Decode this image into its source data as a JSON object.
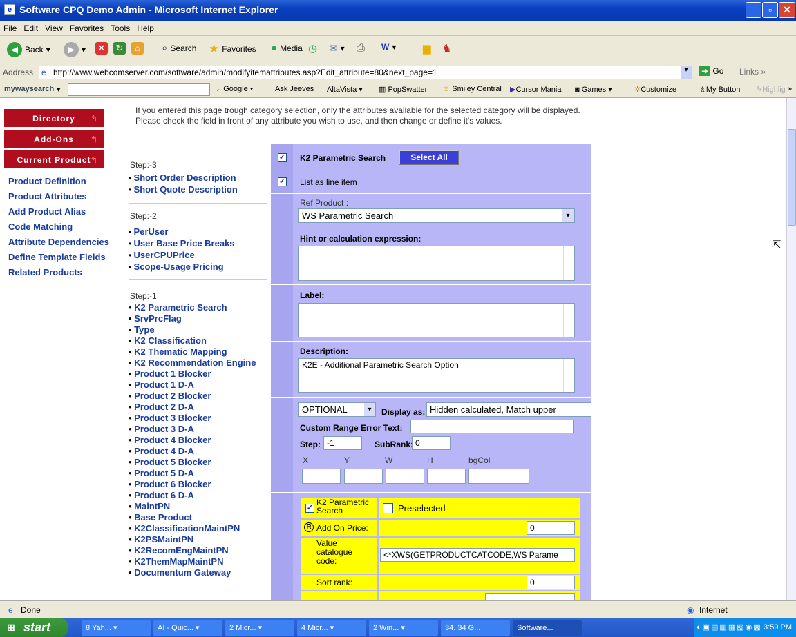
{
  "window": {
    "title": "Software CPQ Demo Admin - Microsoft Internet Explorer"
  },
  "menu": [
    "File",
    "Edit",
    "View",
    "Favorites",
    "Tools",
    "Help"
  ],
  "toolbar": {
    "back": "Back",
    "search": "Search",
    "favorites": "Favorites",
    "media": "Media"
  },
  "address": {
    "label": "Address",
    "url": "http://www.webcomserver.com/software/admin/modifyitemattributes.asp?Edit_attribute=80&next_page=1",
    "go": "Go",
    "links": "Links"
  },
  "myway": {
    "brand": "mywaysearch",
    "items": [
      "Google",
      "Ask Jeeves",
      "AltaVista",
      "PopSwatter",
      "Smiley Central",
      "Cursor Mania",
      "Games",
      "Customize",
      "My Button",
      "Highlight"
    ]
  },
  "intro": "If you entered this page trough category selection, only the attributes available for the selected category will be displayed. Please check the field in front of any attribute you wish to use, and then change or define it's values.",
  "nav": {
    "buttons": [
      "Directory",
      "Add-Ons",
      "Current Product"
    ],
    "links": [
      "Product Definition",
      "Product Attributes",
      "Add Product Alias",
      "Code Matching",
      "Attribute Dependencies",
      "Define Template Fields",
      "Related Products"
    ]
  },
  "steps": [
    {
      "label": "Step:-3",
      "items": [
        "Short Order Description",
        "Short Quote Description"
      ]
    },
    {
      "label": "Step:-2",
      "items": [
        "PerUser",
        "User Base Price Breaks",
        "UserCPUPrice",
        "Scope-Usage Pricing"
      ]
    },
    {
      "label": "Step:-1",
      "items": [
        "K2 Parametric Search",
        "SrvPrcFlag",
        "Type",
        "K2 Classification",
        "K2 Thematic Mapping",
        "K2 Recommendation Engine",
        "Product 1 Blocker",
        "Product 1 D-A",
        "Product 2 Blocker",
        "Product 2 D-A",
        "Product 3 Blocker",
        "Product 3 D-A",
        "Product 4 Blocker",
        "Product 4 D-A",
        "Product 5 Blocker",
        "Product 5 D-A",
        "Product 6 Blocker",
        "Product 6 D-A",
        "MaintPN",
        "Base Product",
        "K2ClassificationMaintPN",
        "K2PSMaintPN",
        "K2RecomEngMaintPN",
        "K2ThemMapMaintPN",
        "Documentum Gateway"
      ]
    }
  ],
  "form": {
    "attr_name": "K2 Parametric Search",
    "select_all": "Select All",
    "list_as_line_item": "List as line item",
    "ref_product_label": "Ref Product :",
    "ref_product_value": "WS Parametric Search",
    "hint_label": "Hint or calculation expression:",
    "hint_value": "",
    "label_label": "Label:",
    "label_value": "",
    "desc_label": "Description:",
    "desc_value": "K2E - Additional Parametric Search Option",
    "optional": "OPTIONAL",
    "display_as_label": "Display as:",
    "display_as_value": "Hidden calculated, Match upper",
    "custom_range_label": "Custom Range Error Text:",
    "custom_range_value": "",
    "step_label": "Step:",
    "step_value": "-1",
    "subrank_label": "SubRank:",
    "subrank_value": "0",
    "grid_headers": [
      "X",
      "Y",
      "W",
      "H",
      "bgCol"
    ],
    "value_row": {
      "name": "K2 Parametric Search",
      "preselected": "Preselected",
      "addon_label": "Add On Price:",
      "addon_value": "0",
      "catcode_label": "Value catalogue code:",
      "catcode_value": "<*XWS(GETPRODUCTCATCODE,WS Parame",
      "sortrank_label": "Sort rank:",
      "sortrank_value": "0"
    }
  },
  "status": {
    "text": "Done",
    "zone": "Internet"
  },
  "taskbar": {
    "start": "start",
    "tasks": [
      "8 Yah...",
      "AI - Quic...",
      "2 Micr...",
      "4 Micr...",
      "2 Win...",
      "34. 34 G...",
      "Software..."
    ],
    "time": "3:59 PM"
  }
}
